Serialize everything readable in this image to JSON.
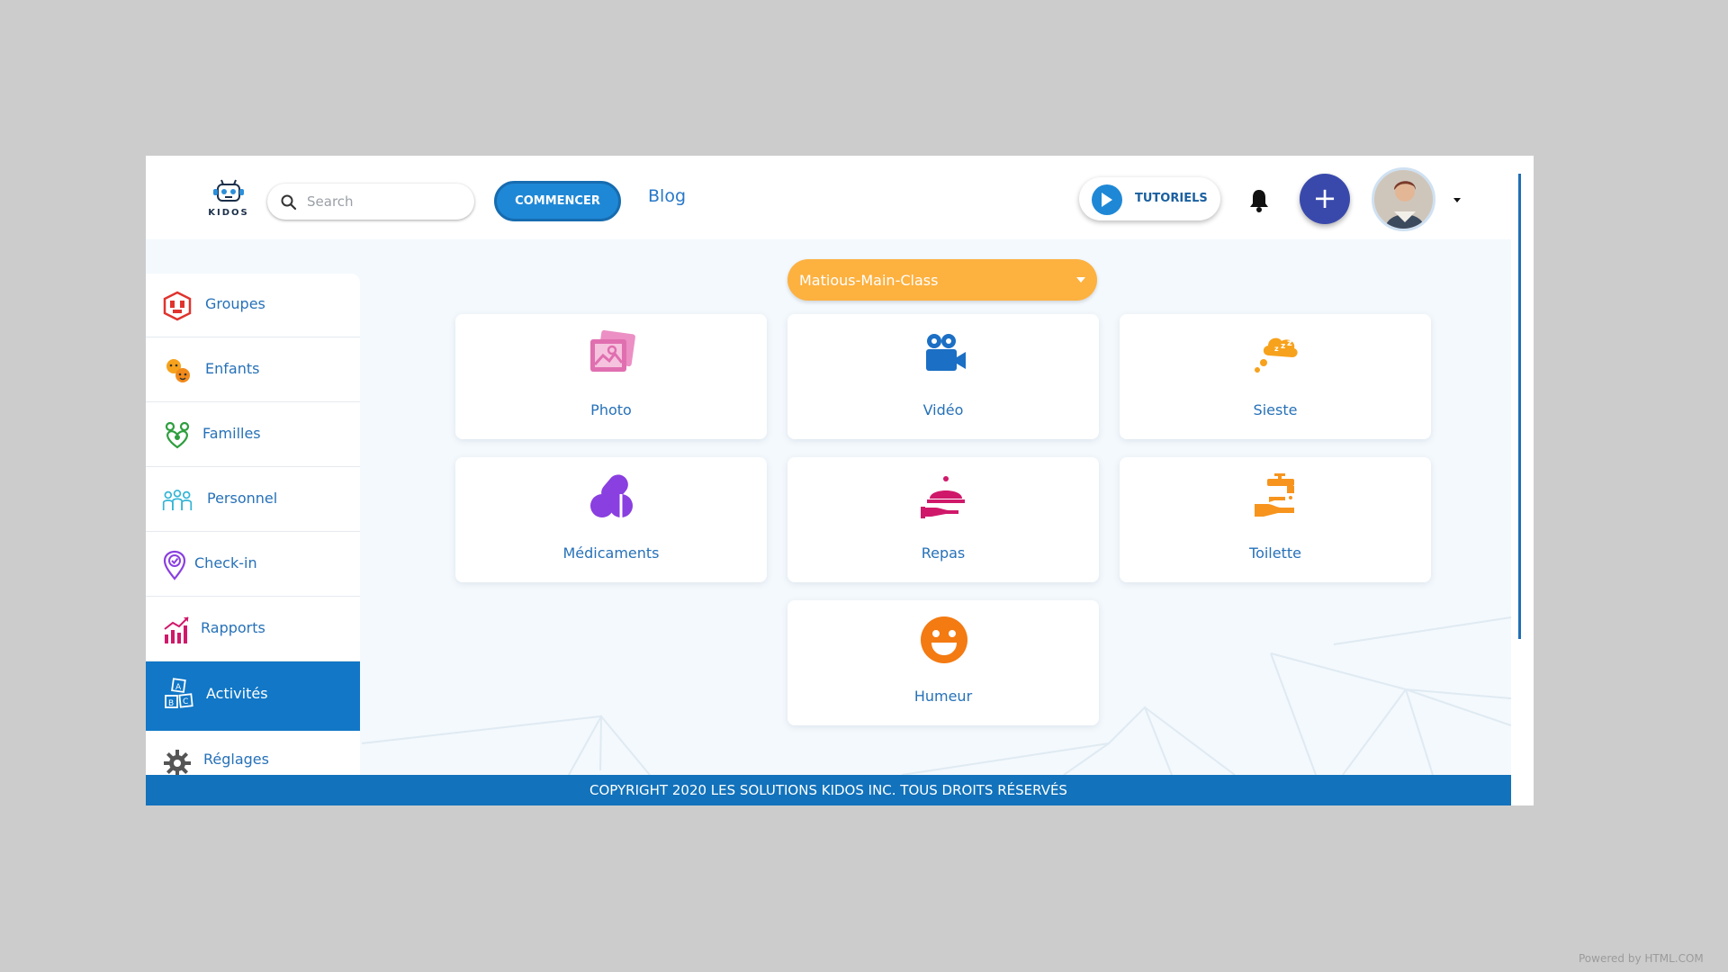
{
  "header": {
    "logo_text": "KIDOS",
    "search": {
      "placeholder": "Search",
      "value": ""
    },
    "commencer_label": "COMMENCER",
    "blog_label": "Blog",
    "tutoriels_label": "TUTORIELS",
    "plus_label": "+"
  },
  "sidebar": {
    "items": [
      {
        "label": "Groupes",
        "icon": "groups-icon",
        "active": false
      },
      {
        "label": "Enfants",
        "icon": "children-icon",
        "active": false
      },
      {
        "label": "Familles",
        "icon": "families-icon",
        "active": false
      },
      {
        "label": "Personnel",
        "icon": "staff-icon",
        "active": false
      },
      {
        "label": "Check-in",
        "icon": "checkin-pin-icon",
        "active": false
      },
      {
        "label": "Rapports",
        "icon": "reports-chart-icon",
        "active": false
      },
      {
        "label": "Activités",
        "icon": "abc-blocks-icon",
        "active": true
      },
      {
        "label": "Réglages",
        "icon": "gear-icon",
        "active": false
      }
    ]
  },
  "class_select": {
    "value": "Matious-Main-Class"
  },
  "activities": [
    {
      "label": "Photo",
      "icon": "photo-icon",
      "color": "#e06fb0"
    },
    {
      "label": "Vidéo",
      "icon": "video-camera-icon",
      "color": "#1b6fc4"
    },
    {
      "label": "Sieste",
      "icon": "nap-cloud-icon",
      "color": "#f7a21c"
    },
    {
      "label": "Médicaments",
      "icon": "pills-icon",
      "color": "#8a3fe0"
    },
    {
      "label": "Repas",
      "icon": "meal-cloche-icon",
      "color": "#d0186a"
    },
    {
      "label": "Toilette",
      "icon": "hand-wash-icon",
      "color": "#f7941d"
    },
    {
      "label": "Humeur",
      "icon": "smiley-icon",
      "color": "#f47a12"
    }
  ],
  "footer": {
    "copyright": "COPYRIGHT 2020 LES SOLUTIONS KIDOS INC. TOUS DROITS RÉSERVÉS"
  },
  "powered_by": "Powered by HTML.COM",
  "colors": {
    "primary": "#1177c6",
    "accent_orange": "#fdb13f",
    "fab": "#3949ab"
  }
}
